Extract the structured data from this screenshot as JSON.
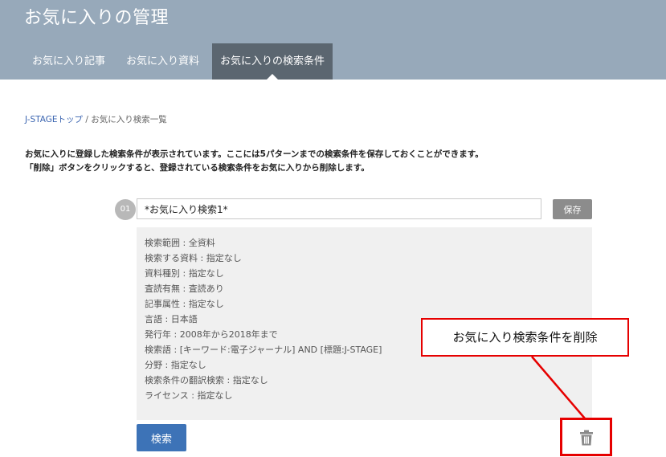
{
  "header": {
    "title": "お気に入りの管理",
    "tabs": [
      {
        "label": "お気に入り記事"
      },
      {
        "label": "お気に入り資料"
      },
      {
        "label": "お気に入りの検索条件"
      }
    ]
  },
  "breadcrumb": {
    "home": "J-STAGEトップ",
    "separator": "/",
    "current": "お気に入り検索一覧"
  },
  "description": {
    "line1": "お気に入りに登録した検索条件が表示されています。ここには5パターンまでの検索条件を保存しておくことができます。",
    "line2": "「削除」ボタンをクリックすると、登録されている検索条件をお気に入りから削除します。"
  },
  "saved_search": {
    "number": "01",
    "name_value": "*お気に入り検索1*",
    "save_label": "保存",
    "conditions": [
      "検索範囲 : 全資料",
      "検索する資料 : 指定なし",
      "資料種別 : 指定なし",
      "査読有無 : 査読あり",
      "記事属性 : 指定なし",
      "言語 : 日本語",
      "発行年 : 2008年から2018年まで",
      "検索語 : [キーワード:電子ジャーナル] AND [標題:J-STAGE]",
      "分野 : 指定なし",
      "検索条件の翻訳検索 : 指定なし",
      "ライセンス : 指定なし"
    ],
    "search_label": "検索"
  },
  "annotation": {
    "text": "お気に入り検索条件を削除",
    "color": "#e60000"
  },
  "icons": {
    "delete": "trash-icon"
  },
  "colors": {
    "header_bg": "#97a9ba",
    "active_tab_bg": "#5b6670",
    "search_button": "#3d73b7"
  }
}
